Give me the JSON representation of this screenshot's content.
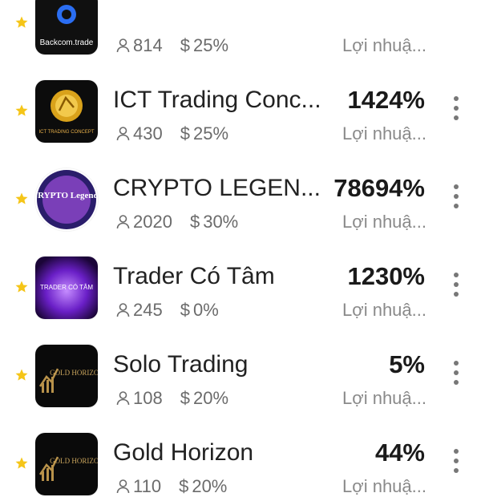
{
  "accent_star_color": "#f5c518",
  "items": [
    {
      "name": "",
      "avatar_text": "Backcom.trade",
      "avatar_icon": "backcom-logo",
      "percent": "",
      "followers": "814",
      "fee": "25%",
      "profit_label": "Lợi nhuậ...",
      "starred": true,
      "has_menu": false
    },
    {
      "name": "ICT Trading Conc...",
      "avatar_text": "ICT TRADING CONCEPT",
      "avatar_icon": "ict-gold-logo",
      "percent": "1424%",
      "followers": "430",
      "fee": "25%",
      "profit_label": "Lợi nhuậ...",
      "starred": true,
      "has_menu": true
    },
    {
      "name": "CRYPTO LEGEN...",
      "avatar_text": "CRYPTO Legends",
      "avatar_icon": "crypto-legends-logo",
      "percent": "78694%",
      "followers": "2020",
      "fee": "30%",
      "profit_label": "Lợi nhuậ...",
      "starred": true,
      "has_menu": true
    },
    {
      "name": "Trader Có Tâm",
      "avatar_text": "TRADER CÓ TÂM",
      "avatar_icon": "trader-co-tam-logo",
      "percent": "1230%",
      "followers": "245",
      "fee": "0%",
      "profit_label": "Lợi nhuậ...",
      "starred": true,
      "has_menu": true
    },
    {
      "name": "Solo Trading",
      "avatar_text": "GOLD HORIZON",
      "avatar_icon": "gold-horizon-logo",
      "percent": "5%",
      "followers": "108",
      "fee": "20%",
      "profit_label": "Lợi nhuậ...",
      "starred": true,
      "has_menu": true
    },
    {
      "name": "Gold Horizon",
      "avatar_text": "GOLD HORIZON",
      "avatar_icon": "gold-horizon-logo",
      "percent": "44%",
      "followers": "110",
      "fee": "20%",
      "profit_label": "Lợi nhuậ...",
      "starred": true,
      "has_menu": true
    }
  ]
}
